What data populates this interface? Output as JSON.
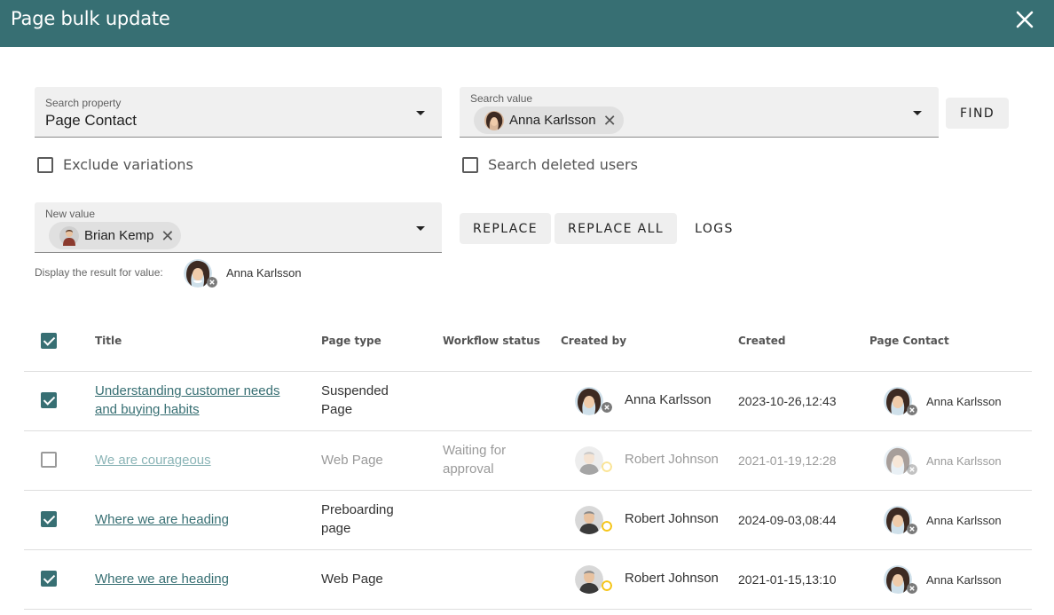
{
  "header": {
    "title": "Page bulk update"
  },
  "search_property": {
    "label": "Search property",
    "value": "Page Contact"
  },
  "search_value": {
    "label": "Search value",
    "chip": "Anna Karlsson"
  },
  "find_label": "FIND",
  "exclude_variations": {
    "label": "Exclude variations",
    "checked": false
  },
  "search_deleted": {
    "label": "Search deleted users",
    "checked": false
  },
  "new_value": {
    "label": "New value",
    "chip": "Brian Kemp"
  },
  "actions": {
    "replace": "REPLACE",
    "replace_all": "REPLACE ALL",
    "logs": "LOGS"
  },
  "display_result": {
    "label": "Display the result for value:",
    "name": "Anna Karlsson"
  },
  "table": {
    "columns": [
      "Title",
      "Page type",
      "Workflow status",
      "Created by",
      "Created",
      "Page Contact"
    ],
    "select_all_checked": true,
    "rows": [
      {
        "checked": true,
        "title_line1": "Understanding customer needs",
        "title_line2": "and buying habits",
        "type_line1": "Suspended",
        "type_line2": "Page",
        "status_line1": "",
        "status_line2": "",
        "created_by": "Anna Karlsson",
        "created": "2023-10-26,12:43",
        "page_contact": "Anna Karlsson",
        "dim": false
      },
      {
        "checked": false,
        "title_line1": "We are courageous",
        "title_line2": "",
        "type_line1": "Web Page",
        "type_line2": "",
        "status_line1": "Waiting for",
        "status_line2": "approval",
        "created_by": "Robert Johnson",
        "created": "2021-01-19,12:28",
        "page_contact": "Anna Karlsson",
        "dim": true
      },
      {
        "checked": true,
        "title_line1": "Where we are heading",
        "title_line2": "",
        "type_line1": "Preboarding",
        "type_line2": "page",
        "status_line1": "",
        "status_line2": "",
        "created_by": "Robert Johnson",
        "created": "2024-09-03,08:44",
        "page_contact": "Anna Karlsson",
        "dim": false
      },
      {
        "checked": true,
        "title_line1": "Where we are heading",
        "title_line2": "",
        "type_line1": "Web Page",
        "type_line2": "",
        "status_line1": "",
        "status_line2": "",
        "created_by": "Robert Johnson",
        "created": "2021-01-15,13:10",
        "page_contact": "Anna Karlsson",
        "dim": false
      }
    ]
  },
  "colors": {
    "brand": "#376f73",
    "field_bg": "#f0f0f0",
    "chip_bg": "#e0e0e0",
    "badge_removed": "#7a7a7a",
    "badge_pending": "#f5c518"
  },
  "icons": {
    "close": "close-icon",
    "dropdown": "caret-down-icon",
    "chip_remove": "chip-remove-icon",
    "avatar": "avatar-photo"
  }
}
